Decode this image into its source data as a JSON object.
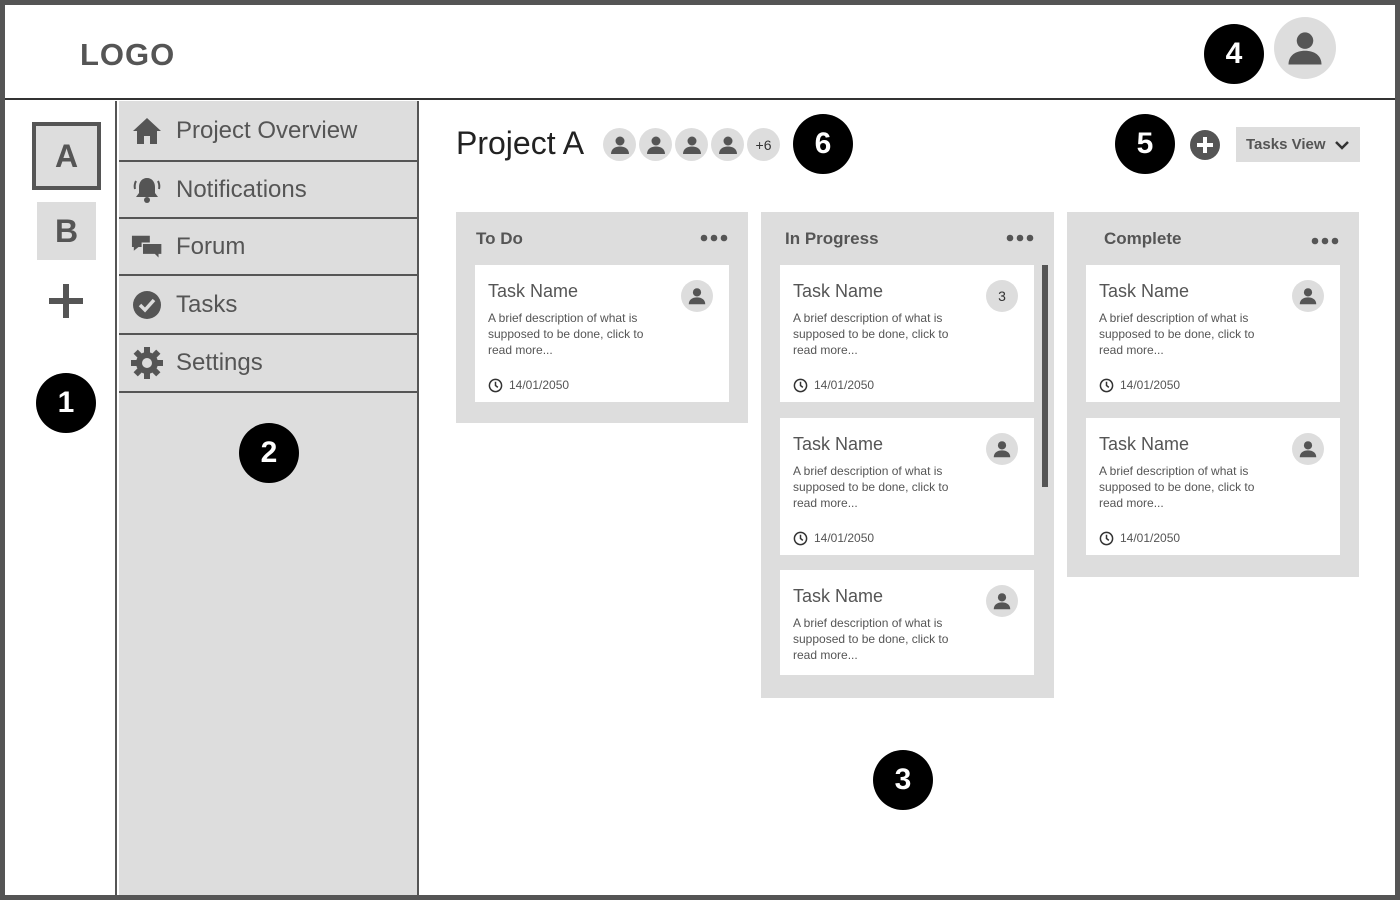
{
  "header": {
    "logo": "LOGO"
  },
  "markers": [
    "1",
    "2",
    "3",
    "4",
    "5",
    "6"
  ],
  "rail": {
    "project_a": "A",
    "project_b": "B"
  },
  "nav": {
    "items": [
      {
        "label": "Project Overview",
        "icon": "home-icon"
      },
      {
        "label": "Notifications",
        "icon": "bell-icon"
      },
      {
        "label": "Forum",
        "icon": "chat-icon"
      },
      {
        "label": "Tasks",
        "icon": "check-circle-icon"
      },
      {
        "label": "Settings",
        "icon": "gear-icon"
      }
    ]
  },
  "project": {
    "title": "Project A",
    "members_more": "+6",
    "view_label": "Tasks View"
  },
  "columns": [
    {
      "title": "To Do",
      "cards": [
        {
          "name": "Task Name",
          "desc": "A brief description of what is supposed to be done, click to read more...",
          "date": "14/01/2050",
          "badge": ""
        }
      ]
    },
    {
      "title": "In Progress",
      "cards": [
        {
          "name": "Task Name",
          "desc": "A brief description of what is supposed to be done, click to read more...",
          "date": "14/01/2050",
          "badge": "3"
        },
        {
          "name": "Task Name",
          "desc": "A brief description of what is supposed to be done, click to read more...",
          "date": "14/01/2050",
          "badge": ""
        },
        {
          "name": "Task Name",
          "desc": "A brief description of what is supposed to be done, click to read more...",
          "date": "",
          "badge": ""
        }
      ]
    },
    {
      "title": "Complete",
      "cards": [
        {
          "name": "Task Name",
          "desc": "A brief description of what is supposed to be done, click to read more...",
          "date": "14/01/2050",
          "badge": ""
        },
        {
          "name": "Task Name",
          "desc": "A brief description of what is supposed to be done, click to read more...",
          "date": "14/01/2050",
          "badge": ""
        }
      ]
    }
  ]
}
